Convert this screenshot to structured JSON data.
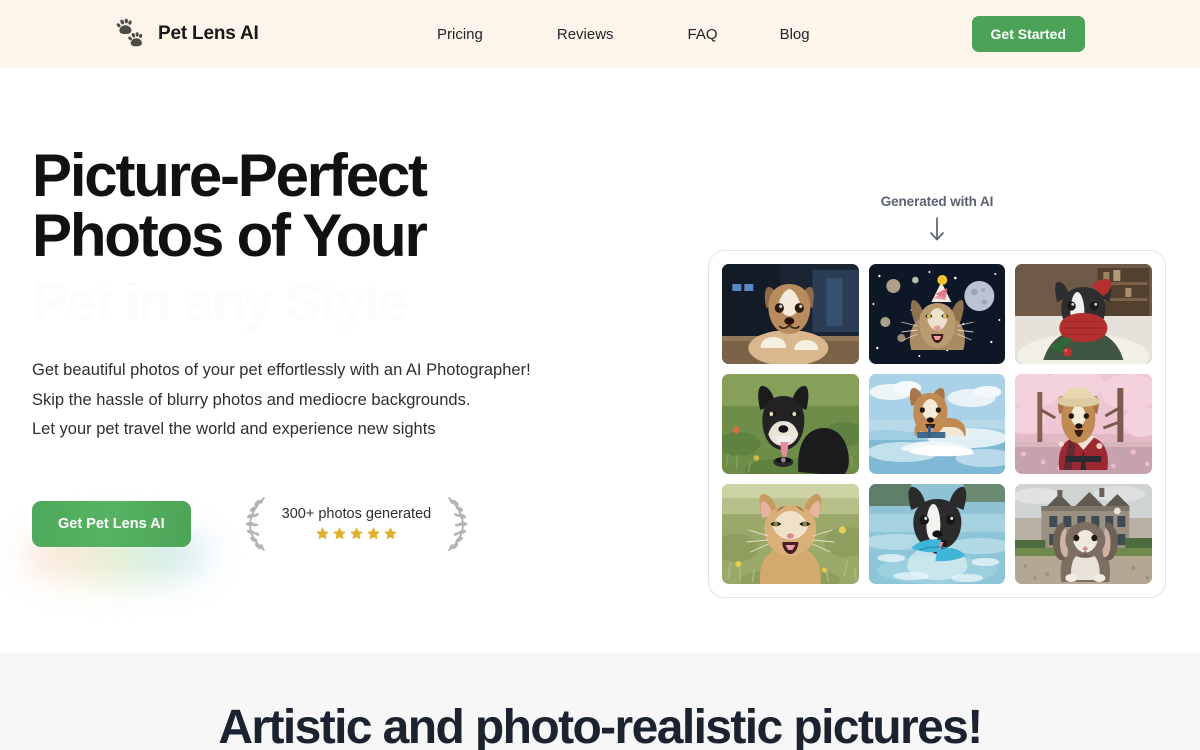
{
  "header": {
    "brand_name": "Pet Lens AI",
    "logo_icon": "paw-prints-icon",
    "nav": [
      {
        "label": "Pricing"
      },
      {
        "label": "Reviews"
      },
      {
        "label": "FAQ"
      },
      {
        "label": "Blog"
      }
    ],
    "cta_label": "Get Started",
    "background_color": "#fdf5ea",
    "accent_color": "#4aa356"
  },
  "hero": {
    "headline_line1": "Picture-Perfect",
    "headline_line2": "Photos of Your",
    "headline_line3": "Pet in any Style",
    "paragraph_line1": "Get beautiful photos of your pet effortlessly with an AI Photographer!",
    "paragraph_line2": "Skip the hassle of blurry photos and mediocre backgrounds.",
    "paragraph_line3": "Let your pet travel the world and experience new sights",
    "cta_label": "Get Pet Lens AI",
    "proof_text": "300+ photos generated",
    "rating": 5,
    "rating_max": 5,
    "star_color": "#e3b02c",
    "laurel_icon": "laurel-wreath-icon"
  },
  "gallery": {
    "label": "Generated with AI",
    "arrow_icon": "arrow-down-icon",
    "photos": [
      {
        "caption": "Corgi resting indoors at night"
      },
      {
        "caption": "Maine coon cat with party hat in space"
      },
      {
        "caption": "Boston terrier in red knit sweater"
      },
      {
        "caption": "Black shiba inu smiling on grass"
      },
      {
        "caption": "Corgi surfing a wave"
      },
      {
        "caption": "Corgi in kimono under cherry blossoms"
      },
      {
        "caption": "Ginger kitten in a meadow"
      },
      {
        "caption": "Boston terrier swimming in a lake"
      },
      {
        "caption": "Lop rabbit in front of a manor house"
      }
    ]
  },
  "section_two": {
    "title": "Artistic and photo-realistic pictures!",
    "background_color": "#f7f7f8"
  }
}
